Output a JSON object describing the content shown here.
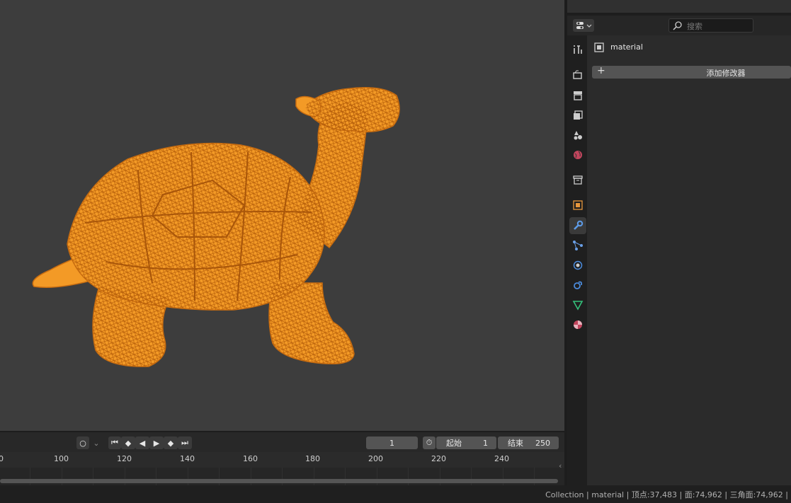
{
  "properties": {
    "search_placeholder": "搜索",
    "object_name": "material",
    "add_modifier": "添加修改器",
    "tabs": [
      "tool-icon",
      "render-icon",
      "output-icon",
      "view-layer-icon",
      "scene-icon",
      "world-icon",
      "collection-icon",
      "object-icon",
      "modifier-icon",
      "particles-icon",
      "physics-icon",
      "constraints-icon",
      "data-icon",
      "material-icon"
    ],
    "active_tab": "modifier-icon"
  },
  "timeline": {
    "current_frame": "1",
    "start_label": "起始",
    "start_value": "1",
    "end_label": "结束",
    "end_value": "250",
    "ruler_labels": [
      "0",
      "100",
      "120",
      "140",
      "160",
      "180",
      "200",
      "220",
      "240"
    ]
  },
  "status": {
    "text": "Collection | material | 顶点:37,483 | 面:74,962 | 三角面:74,962 |"
  },
  "colors": {
    "wireframe": "#f39a26",
    "accent_blue": "#4b8bdc"
  }
}
